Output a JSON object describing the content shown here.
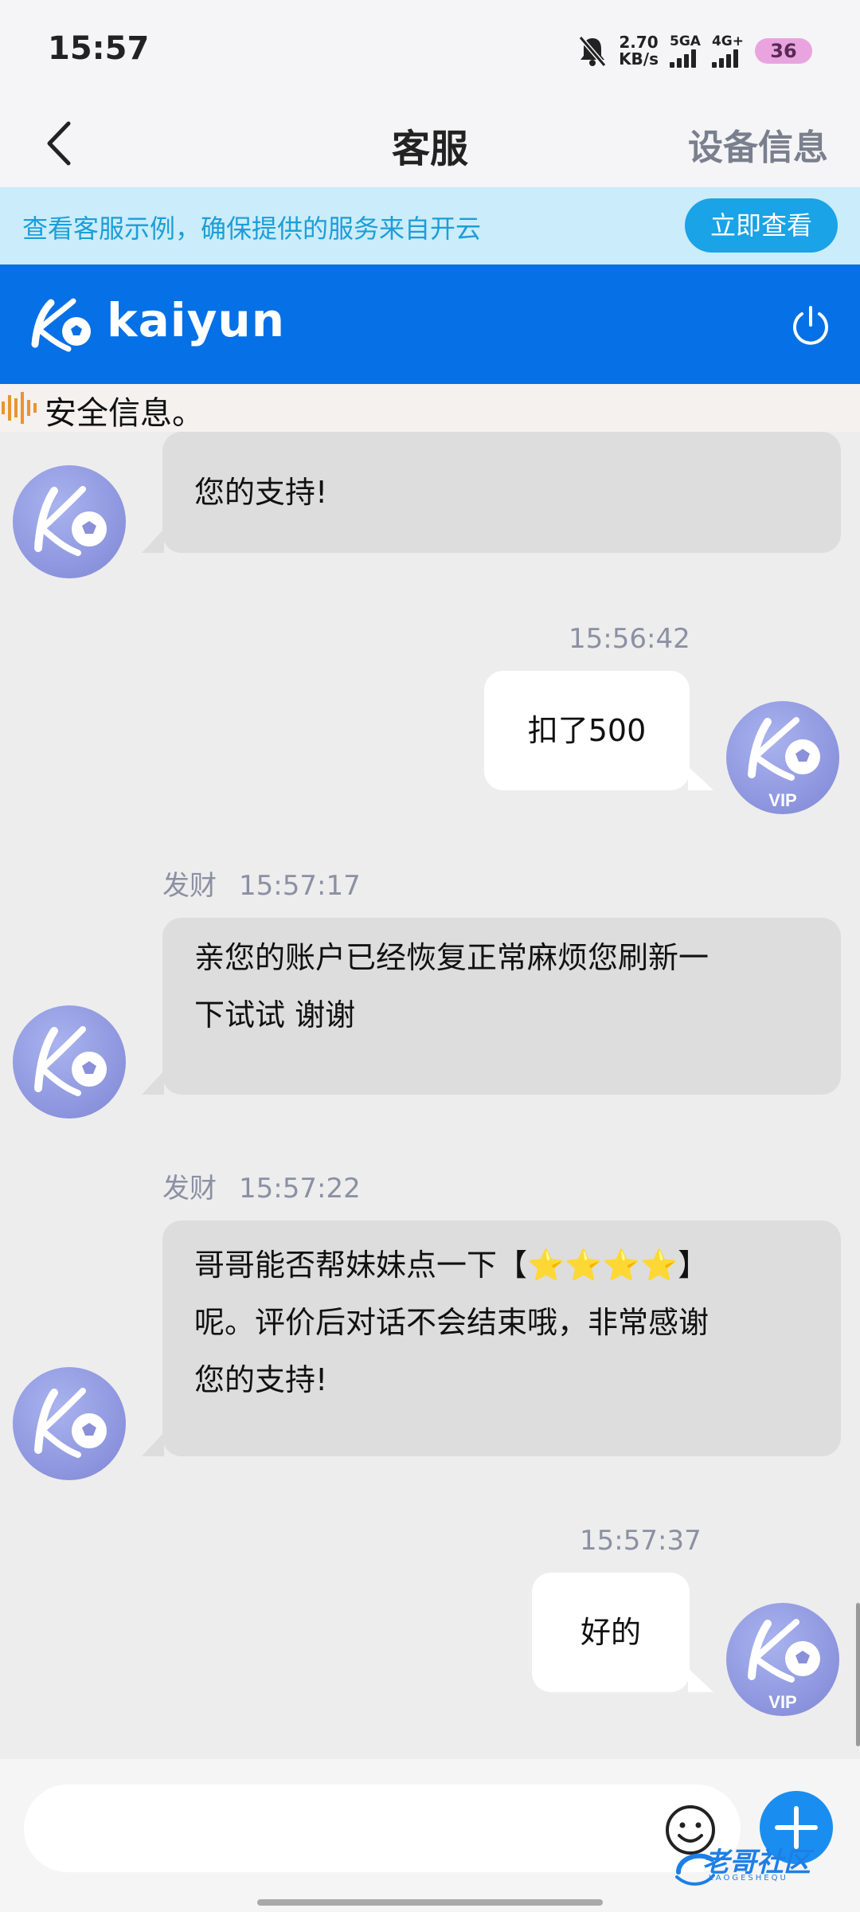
{
  "status_bar": {
    "time": "15:57",
    "net_speed_value": "2.70",
    "net_speed_unit": "KB/s",
    "sim1_label": "5GA",
    "sim2_label": "4G+",
    "battery": "36",
    "icons": [
      "bell-muted-icon",
      "signal-icon",
      "battery-icon"
    ]
  },
  "nav": {
    "title": "客服",
    "right_label": "设备信息"
  },
  "notice": {
    "text": "查看客服示例，确保提供的服务来自开云",
    "button_label": "立即查看"
  },
  "brand": {
    "logo_text": "kaiyun"
  },
  "marquee": {
    "text": "安全信息。"
  },
  "messages": [
    {
      "direction": "in",
      "sender": "",
      "time": "",
      "text": "您的支持!"
    },
    {
      "direction": "out",
      "time": "15:56:42",
      "text": "扣了500",
      "avatar_badge": "VIP"
    },
    {
      "direction": "in",
      "sender": "发财",
      "time": "15:57:17",
      "line1": "亲您的账户已经恢复正常麻烦您刷新一",
      "line2": "下试试 谢谢"
    },
    {
      "direction": "in",
      "sender": "发财",
      "time": "15:57:22",
      "line1_prefix": " 哥哥能否帮妹妹点一下【",
      "stars": "⭐⭐⭐⭐",
      "line1_suffix": "】",
      "line2": "呢。评价后对话不会结束哦，非常感谢",
      "line3": "您的支持!"
    },
    {
      "direction": "out",
      "time": "15:57:37",
      "text": "好的",
      "avatar_badge": "VIP"
    }
  ],
  "input": {
    "placeholder": ""
  },
  "watermark": {
    "text": "老哥社区",
    "sub": "LAOGESHEQU"
  },
  "colors": {
    "brand_blue": "#0670e6",
    "notice_bg": "#cbecfa",
    "notice_text": "#1c9ed8",
    "meta_gray": "#8c90a3"
  }
}
